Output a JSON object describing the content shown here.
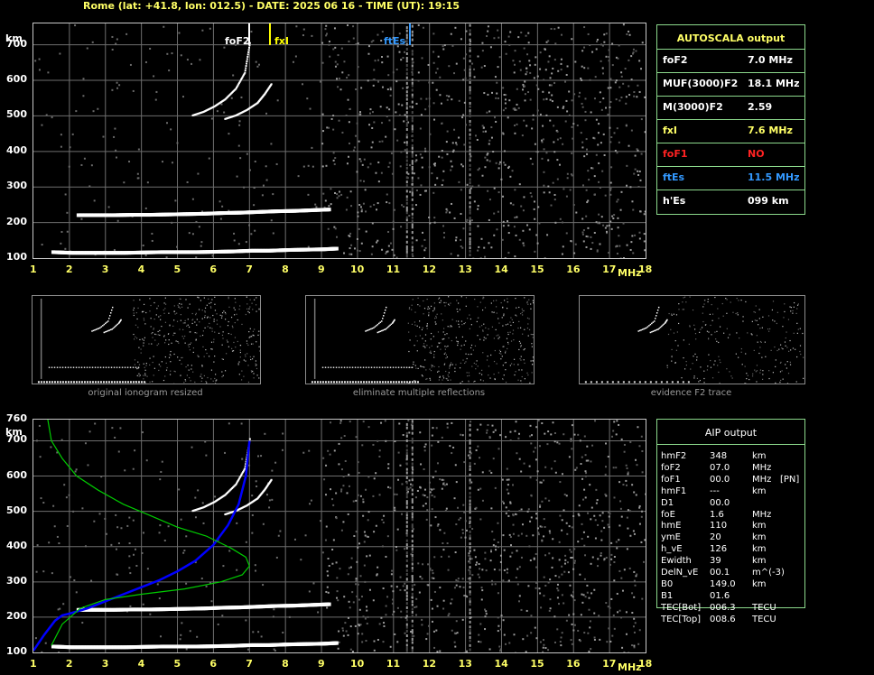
{
  "header": {
    "title": "Rome (lat: +41.8, lon: 012.5) - DATE: 2025 06 16 - TIME (UT): 19:15"
  },
  "axes": {
    "y_unit": "km",
    "x_unit": "MHz",
    "x_ticks": [
      "1",
      "2",
      "3",
      "4",
      "5",
      "6",
      "7",
      "8",
      "9",
      "10",
      "11",
      "12",
      "13",
      "14",
      "15",
      "16",
      "17",
      "18"
    ],
    "y_ticks_top": [
      "700",
      "600",
      "500",
      "400",
      "300",
      "200",
      "100"
    ],
    "y_ticks_bottom": [
      "760",
      "700",
      "600",
      "500",
      "400",
      "300",
      "200",
      "100"
    ]
  },
  "markers": {
    "foF2_label": "foF2",
    "fxI_label": "fxI",
    "ftEs_label": "ftEs",
    "fxI_color": "#ffff00",
    "ftEs_color": "#3399ff"
  },
  "autoscala": {
    "title": "AUTOSCALA output",
    "rows": [
      {
        "name": "foF2",
        "value": "7.0 MHz",
        "color": "#ffffff"
      },
      {
        "name": "MUF(3000)F2",
        "value": "18.1 MHz",
        "color": "#ffffff"
      },
      {
        "name": "M(3000)F2",
        "value": "2.59",
        "color": "#ffffff"
      },
      {
        "name": "fxI",
        "value": "7.6 MHz",
        "color": "#ffff66"
      },
      {
        "name": "foF1",
        "value": "NO",
        "color": "#ff2222"
      },
      {
        "name": "ftEs",
        "value": "11.5 MHz",
        "color": "#3399ff"
      },
      {
        "name": "h'Es",
        "value": "099    km",
        "color": "#ffffff"
      }
    ]
  },
  "thumbnails": [
    {
      "caption": "original ionogram resized"
    },
    {
      "caption": "eliminate multiple reflections"
    },
    {
      "caption": "evidence F2 trace"
    }
  ],
  "aip": {
    "title": "AIP output",
    "rows": [
      {
        "name": "hmF2",
        "value": "348",
        "unit": "km",
        "extra": ""
      },
      {
        "name": "foF2",
        "value": "07.0",
        "unit": "MHz",
        "extra": ""
      },
      {
        "name": "foF1",
        "value": "00.0",
        "unit": "MHz",
        "extra": "[PN]"
      },
      {
        "name": "hmF1",
        "value": "---",
        "unit": "km",
        "extra": ""
      },
      {
        "name": "D1",
        "value": "00.0",
        "unit": "",
        "extra": ""
      },
      {
        "name": "foE",
        "value": "1.6",
        "unit": "MHz",
        "extra": ""
      },
      {
        "name": "hmE",
        "value": "110",
        "unit": "km",
        "extra": ""
      },
      {
        "name": "ymE",
        "value": "20",
        "unit": "km",
        "extra": ""
      },
      {
        "name": "h_vE",
        "value": "126",
        "unit": "km",
        "extra": ""
      },
      {
        "name": "Ewidth",
        "value": "39",
        "unit": "km",
        "extra": ""
      },
      {
        "name": "DelN_vE",
        "value": "00.1",
        "unit": "m^(-3)",
        "extra": ""
      },
      {
        "name": "B0",
        "value": "149.0",
        "unit": "km",
        "extra": ""
      },
      {
        "name": "B1",
        "value": "01.6",
        "unit": "",
        "extra": ""
      },
      {
        "name": "TEC[Bot]",
        "value": "006.3",
        "unit": "TECU",
        "extra": ""
      },
      {
        "name": "TEC[Top]",
        "value": "008.6",
        "unit": "TECU",
        "extra": ""
      }
    ]
  },
  "chart_data": [
    {
      "type": "scatter",
      "name": "ionogram-top",
      "xlim": [
        1,
        18
      ],
      "ylim": [
        100,
        760
      ],
      "grid": true,
      "series": [
        {
          "name": "",
          "color": "#ffffff",
          "kind": "E-layer",
          "x": [
            1.5,
            2,
            2.5,
            3,
            3.5,
            4,
            4.5,
            5,
            5.5,
            6,
            6.5,
            7,
            7.5,
            8,
            8.5,
            9,
            9.4
          ],
          "y": [
            118,
            116,
            116,
            116,
            116,
            117,
            118,
            118,
            118,
            119,
            120,
            122,
            122,
            124,
            125,
            126,
            128
          ]
        },
        {
          "name": "",
          "color": "#ffffff",
          "kind": "F-layer-2hop",
          "x": [
            2.2,
            2.7,
            3.2,
            3.7,
            4.2,
            4.7,
            5.2,
            5.7,
            6.2,
            6.7,
            7.2,
            7.7,
            8.2,
            8.7,
            9.2
          ],
          "y": [
            222,
            222,
            222,
            223,
            223,
            224,
            225,
            226,
            228,
            229,
            231,
            233,
            234,
            236,
            238
          ]
        },
        {
          "name": "",
          "color": "#ffffff",
          "kind": "F2-O-trace",
          "x": [
            5.4,
            5.7,
            6.0,
            6.3,
            6.6,
            6.85,
            7.0
          ],
          "y": [
            500,
            510,
            525,
            545,
            575,
            620,
            710
          ]
        },
        {
          "name": "",
          "color": "#ffffff",
          "kind": "F2-X-trace",
          "x": [
            6.3,
            6.6,
            6.9,
            7.2,
            7.4,
            7.6
          ],
          "y": [
            490,
            500,
            515,
            535,
            560,
            590
          ]
        }
      ]
    },
    {
      "type": "line",
      "name": "ionogram-bottom",
      "xlim": [
        1,
        18
      ],
      "ylim": [
        100,
        760
      ],
      "grid": true,
      "series": [
        {
          "name": "",
          "color": "#0000ff",
          "x": [
            1.0,
            1.3,
            1.6,
            1.8,
            2.0,
            2.5,
            3.0,
            3.5,
            4.0,
            4.5,
            5.0,
            5.5,
            6.0,
            6.4,
            6.7,
            6.9,
            7.0
          ],
          "y": [
            105,
            150,
            190,
            205,
            210,
            225,
            245,
            265,
            285,
            305,
            330,
            360,
            405,
            460,
            520,
            600,
            700
          ]
        },
        {
          "name": "",
          "color": "#00cc00",
          "x": [
            1.4,
            1.5,
            1.8,
            2.2,
            2.8,
            3.5,
            4.2,
            5.0,
            5.8,
            6.5,
            6.9,
            7.0,
            6.8,
            6.2,
            5.2,
            4.0,
            3.0,
            2.3,
            1.8,
            1.5
          ],
          "y": [
            760,
            700,
            650,
            600,
            560,
            520,
            490,
            455,
            430,
            395,
            370,
            345,
            320,
            300,
            280,
            265,
            250,
            225,
            180,
            120
          ]
        }
      ]
    }
  ]
}
